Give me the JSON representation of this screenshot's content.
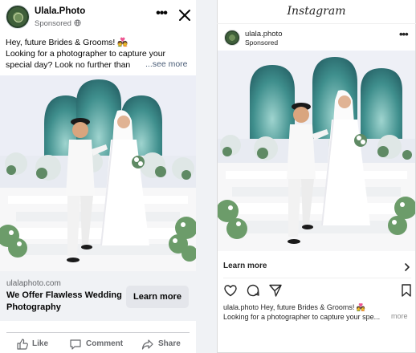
{
  "facebook": {
    "page_name": "Ulala.Photo",
    "sponsored": "Sponsored",
    "globe_icon": "globe-icon",
    "more_icon": "more-options-icon",
    "close_icon": "close-icon",
    "post_lines": [
      "Hey, future Brides & Grooms! 💑",
      "Looking for a photographer to capture your",
      "special day? Look no further than"
    ],
    "see_more": "...see more",
    "link_domain": "ulalaphoto.com",
    "link_headline": "We Offer Flawless Wedding Photography",
    "cta_label": "Learn more",
    "actions": [
      {
        "label": "Like",
        "icon": "like-thumb-icon"
      },
      {
        "label": "Comment",
        "icon": "comment-bubble-icon"
      },
      {
        "label": "Share",
        "icon": "share-arrow-icon"
      }
    ]
  },
  "instagram": {
    "logo": "Instagram",
    "username": "ulala.photo",
    "sponsored": "Sponsored",
    "more_icon": "more-options-icon",
    "cta_label": "Learn more",
    "cta_icon": "chevron-right-icon",
    "action_icons": [
      "heart-icon",
      "comment-icon",
      "send-icon",
      "bookmark-icon"
    ],
    "caption_lines": [
      "ulala.photo Hey, future Brides & Grooms! 💑",
      "Looking for a photographer to capture your spe..."
    ],
    "more_label": "more"
  },
  "colors": {
    "facebook_link_bg": "#f0f2f5",
    "facebook_button_bg": "#e4e6eb",
    "muted_text": "#65676b",
    "instagram_text": "#262626",
    "instagram_muted": "#8e8e8e"
  }
}
